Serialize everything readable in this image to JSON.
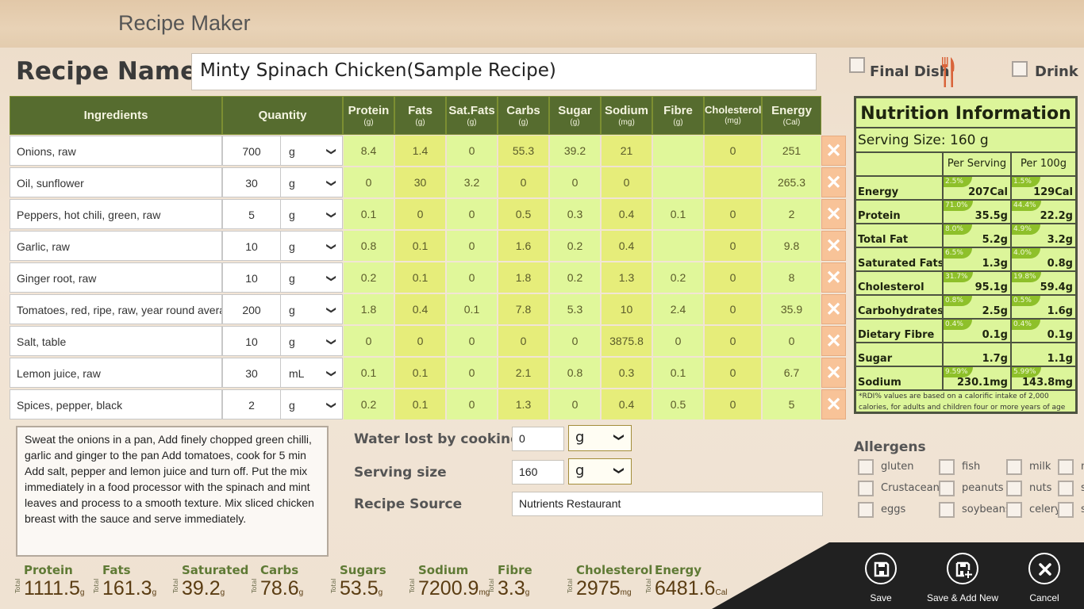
{
  "app": {
    "title": "Recipe Maker"
  },
  "recipe": {
    "name_label": "Recipe Name",
    "name_value": "Minty Spinach Chicken(Sample Recipe)",
    "final_dish_label": "Final Dish",
    "final_dish_checked": false,
    "drink_label": "Drink",
    "drink_checked": false
  },
  "table": {
    "headers": {
      "ingredients": "Ingredients",
      "quantity": "Quantity",
      "nutrients": [
        {
          "label": "Protein",
          "unit": "(g)"
        },
        {
          "label": "Fats",
          "unit": "(g)"
        },
        {
          "label": "Sat.Fats",
          "unit": "(g)"
        },
        {
          "label": "Carbs",
          "unit": "(g)"
        },
        {
          "label": "Sugar",
          "unit": "(g)"
        },
        {
          "label": "Sodium",
          "unit": "(mg)"
        },
        {
          "label": "Fibre",
          "unit": "(g)"
        },
        {
          "label": "Cholesterol",
          "unit": "(mg)"
        },
        {
          "label": "Energy",
          "unit": "(Cal)"
        }
      ]
    },
    "rows": [
      {
        "ingredient": "Onions, raw",
        "qty": "700",
        "unit": "g",
        "values": [
          "8.4",
          "1.4",
          "0",
          "55.3",
          "39.2",
          "21",
          "",
          "0",
          "251"
        ]
      },
      {
        "ingredient": "Oil, sunflower",
        "qty": "30",
        "unit": "g",
        "values": [
          "0",
          "30",
          "3.2",
          "0",
          "0",
          "0",
          "",
          "",
          "265.3"
        ]
      },
      {
        "ingredient": "Peppers, hot chili, green, raw",
        "qty": "5",
        "unit": "g",
        "values": [
          "0.1",
          "0",
          "0",
          "0.5",
          "0.3",
          "0.4",
          "0.1",
          "0",
          "2"
        ]
      },
      {
        "ingredient": "Garlic, raw",
        "qty": "10",
        "unit": "g",
        "values": [
          "0.8",
          "0.1",
          "0",
          "1.6",
          "0.2",
          "0.4",
          "",
          "0",
          "9.8"
        ]
      },
      {
        "ingredient": "Ginger root, raw",
        "qty": "10",
        "unit": "g",
        "values": [
          "0.2",
          "0.1",
          "0",
          "1.8",
          "0.2",
          "1.3",
          "0.2",
          "0",
          "8"
        ]
      },
      {
        "ingredient": "Tomatoes, red, ripe, raw, year round average",
        "qty": "200",
        "unit": "g",
        "values": [
          "1.8",
          "0.4",
          "0.1",
          "7.8",
          "5.3",
          "10",
          "2.4",
          "0",
          "35.9"
        ]
      },
      {
        "ingredient": "Salt, table",
        "qty": "10",
        "unit": "g",
        "values": [
          "0",
          "0",
          "0",
          "0",
          "0",
          "3875.8",
          "0",
          "0",
          "0"
        ]
      },
      {
        "ingredient": "Lemon juice, raw",
        "qty": "30",
        "unit": "mL",
        "values": [
          "0.1",
          "0.1",
          "0",
          "2.1",
          "0.8",
          "0.3",
          "0.1",
          "0",
          "6.7"
        ]
      },
      {
        "ingredient": "Spices, pepper, black",
        "qty": "2",
        "unit": "g",
        "values": [
          "0.2",
          "0.1",
          "0",
          "1.3",
          "0",
          "0.4",
          "0.5",
          "0",
          "5"
        ]
      }
    ],
    "delete_icon": "close-icon"
  },
  "nutrition": {
    "title": "Nutrition Information",
    "serving_size": "Serving Size: 160 g",
    "col_per_serving": "Per Serving",
    "col_per_100g": "Per 100g",
    "rows": [
      {
        "label": "Energy",
        "serving": "207Cal",
        "serving_pct": "2.5%",
        "per100": "129Cal",
        "per100_pct": "1.5%"
      },
      {
        "label": "Protein",
        "serving": "35.5g",
        "serving_pct": "71.0%",
        "per100": "22.2g",
        "per100_pct": "44.4%"
      },
      {
        "label": "Total Fat",
        "serving": "5.2g",
        "serving_pct": "8.0%",
        "per100": "3.2g",
        "per100_pct": "4.9%"
      },
      {
        "label": "Saturated Fats",
        "serving": "1.3g",
        "serving_pct": "6.5%",
        "per100": "0.8g",
        "per100_pct": "4.0%"
      },
      {
        "label": "Cholesterol",
        "serving": "95.1g",
        "serving_pct": "31.7%",
        "per100": "59.4g",
        "per100_pct": "19.8%"
      },
      {
        "label": "Carbohydrates",
        "serving": "2.5g",
        "serving_pct": "0.8%",
        "per100": "1.6g",
        "per100_pct": "0.5%"
      },
      {
        "label": "Dietary Fibre",
        "serving": "0.1g",
        "serving_pct": "0.4%",
        "per100": "0.1g",
        "per100_pct": "0.4%"
      },
      {
        "label": "Sugar",
        "serving": "1.7g",
        "serving_pct": "",
        "per100": "1.1g",
        "per100_pct": ""
      },
      {
        "label": "Sodium",
        "serving": "230.1mg",
        "serving_pct": "9.59%",
        "per100": "143.8mg",
        "per100_pct": "5.99%"
      }
    ],
    "note": "*RDI% values are based on a calorific intake of 2,000 calories, for adults and children four or more years of age"
  },
  "allergens": {
    "title": "Allergens",
    "items": [
      {
        "label": "gluten",
        "checked": false
      },
      {
        "label": "fish",
        "checked": false
      },
      {
        "label": "milk",
        "checked": false
      },
      {
        "label": "m",
        "checked": false
      },
      {
        "label": "Crustaceans",
        "checked": false
      },
      {
        "label": "peanuts",
        "checked": false
      },
      {
        "label": "nuts",
        "checked": false
      },
      {
        "label": "se",
        "checked": false
      },
      {
        "label": "eggs",
        "checked": false
      },
      {
        "label": "soybeans",
        "checked": false
      },
      {
        "label": "celery",
        "checked": false
      },
      {
        "label": "su",
        "checked": false
      }
    ]
  },
  "method": {
    "text": "Sweat the onions in a pan,  Add finely chopped green chilli, garlic and ginger to the pan Add tomatoes, cook for 5 min Add salt, pepper and lemon juice and turn off.  Put the mix immediately in a food processor with the spinach and mint leaves and process to a smooth texture.  Mix sliced chicken breast with the sauce and serve immediately."
  },
  "fields": {
    "water_lost_label": "Water lost by cooking",
    "water_lost_value": "0",
    "water_lost_unit": "g",
    "serving_size_label": "Serving size",
    "serving_size_value": "160",
    "serving_size_unit": "g",
    "source_label": "Recipe Source",
    "source_value": "Nutrients Restaurant"
  },
  "totals": {
    "side_label": "Total",
    "items": [
      {
        "name": "Protein",
        "value": "1111.5",
        "unit": "g"
      },
      {
        "name": "Fats",
        "value": "161.3",
        "unit": "g"
      },
      {
        "name": "Saturated",
        "value": "39.2",
        "unit": "g"
      },
      {
        "name": "Carbs",
        "value": "78.6",
        "unit": "g"
      },
      {
        "name": "Sugars",
        "value": "53.5",
        "unit": "g"
      },
      {
        "name": "Sodium",
        "value": "7200.9",
        "unit": "mg"
      },
      {
        "name": "Fibre",
        "value": "3.3",
        "unit": "g"
      },
      {
        "name": "Cholesterol",
        "value": "2975",
        "unit": "mg"
      },
      {
        "name": "Energy",
        "value": "6481.6",
        "unit": "Cal"
      }
    ]
  },
  "actions": {
    "save": "Save",
    "save_add_new": "Save & Add New",
    "cancel": "Cancel"
  },
  "colors": {
    "header_green": "#566c2f",
    "cell_light": "#e0f79a",
    "cell_dark": "#e6ed7a",
    "delete_bg": "#f8c398",
    "nutrition_bg": "#dcf59a",
    "rdi_badge": "#8ec02a",
    "action_bar": "#212121",
    "fork_icon": "#d9643a"
  }
}
